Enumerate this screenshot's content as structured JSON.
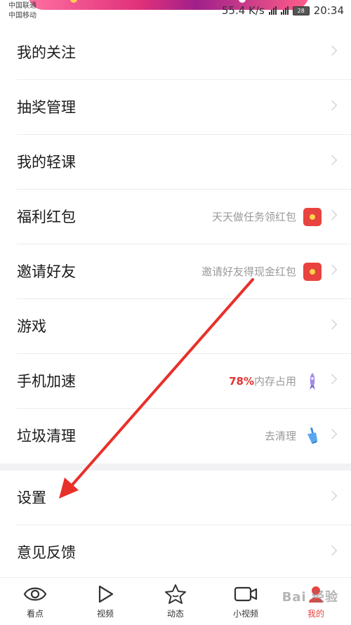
{
  "status_bar": {
    "carrier1": "中国联通",
    "carrier2": "中国移动",
    "speed": "55.4 K/s",
    "battery": "28",
    "time": "20:34"
  },
  "menu": [
    {
      "label": "我的关注"
    },
    {
      "label": "抽奖管理"
    },
    {
      "label": "我的轻课"
    },
    {
      "label": "福利红包",
      "hint": "天天做任务领红包",
      "icon": "red-envelope-icon"
    },
    {
      "label": "邀请好友",
      "hint": "邀请好友得现金红包",
      "icon": "red-envelope-icon"
    },
    {
      "label": "游戏"
    },
    {
      "label": "手机加速",
      "hint_highlight": "78%",
      "hint": "内存占用",
      "icon": "rocket-icon"
    },
    {
      "label": "垃圾清理",
      "hint": "去清理",
      "icon": "broom-icon"
    },
    {
      "label": "设置"
    },
    {
      "label": "意见反馈"
    }
  ],
  "tabs": [
    {
      "label": "看点",
      "icon": "eye-icon"
    },
    {
      "label": "视频",
      "icon": "play-icon"
    },
    {
      "label": "动态",
      "icon": "star-icon"
    },
    {
      "label": "小视频",
      "icon": "video-camera-icon"
    },
    {
      "label": "我的",
      "icon": "profile-icon",
      "active": true
    }
  ],
  "watermark": "Bai 经验",
  "colors": {
    "accent": "#e8433f",
    "annotation_arrow": "#e8302a"
  }
}
